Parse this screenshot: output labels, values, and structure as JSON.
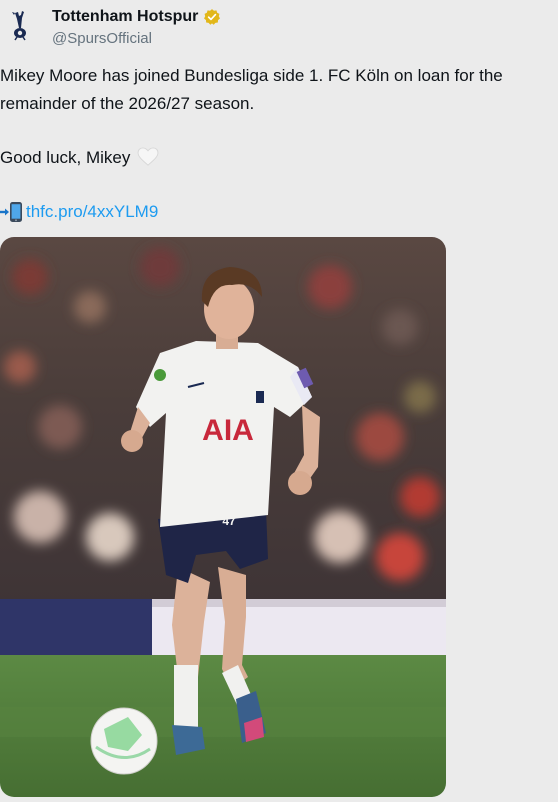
{
  "tweet": {
    "author": {
      "display_name": "Tottenham Hotspur",
      "handle": "@SpursOfficial",
      "verified_badge": "gold-verified-icon",
      "avatar_icon": "spurs-cockerel-icon"
    },
    "text_lines": [
      "Mikey Moore has joined Bundesliga side 1. FC Köln on loan for the",
      "remainder of the 2026/27 season."
    ],
    "sign_off": "Good luck, Mikey",
    "sign_off_emoji": "white-heart-icon",
    "link_emoji": "mobile-phone-arrow-icon",
    "link_text": "thfc.pro/4xxYLM9",
    "media": {
      "shirt_sponsor": "AIA",
      "shirt_number": "47"
    }
  },
  "colors": {
    "background": "#ebebeb",
    "link": "#1d9bf0",
    "verified_gold": "#e2b719",
    "handle_gray": "#65737e",
    "pitch_green": "#4f7a3a",
    "kit_white": "#f2f2f0",
    "shorts_navy": "#1f2547",
    "sponsor_red": "#c8283b"
  }
}
